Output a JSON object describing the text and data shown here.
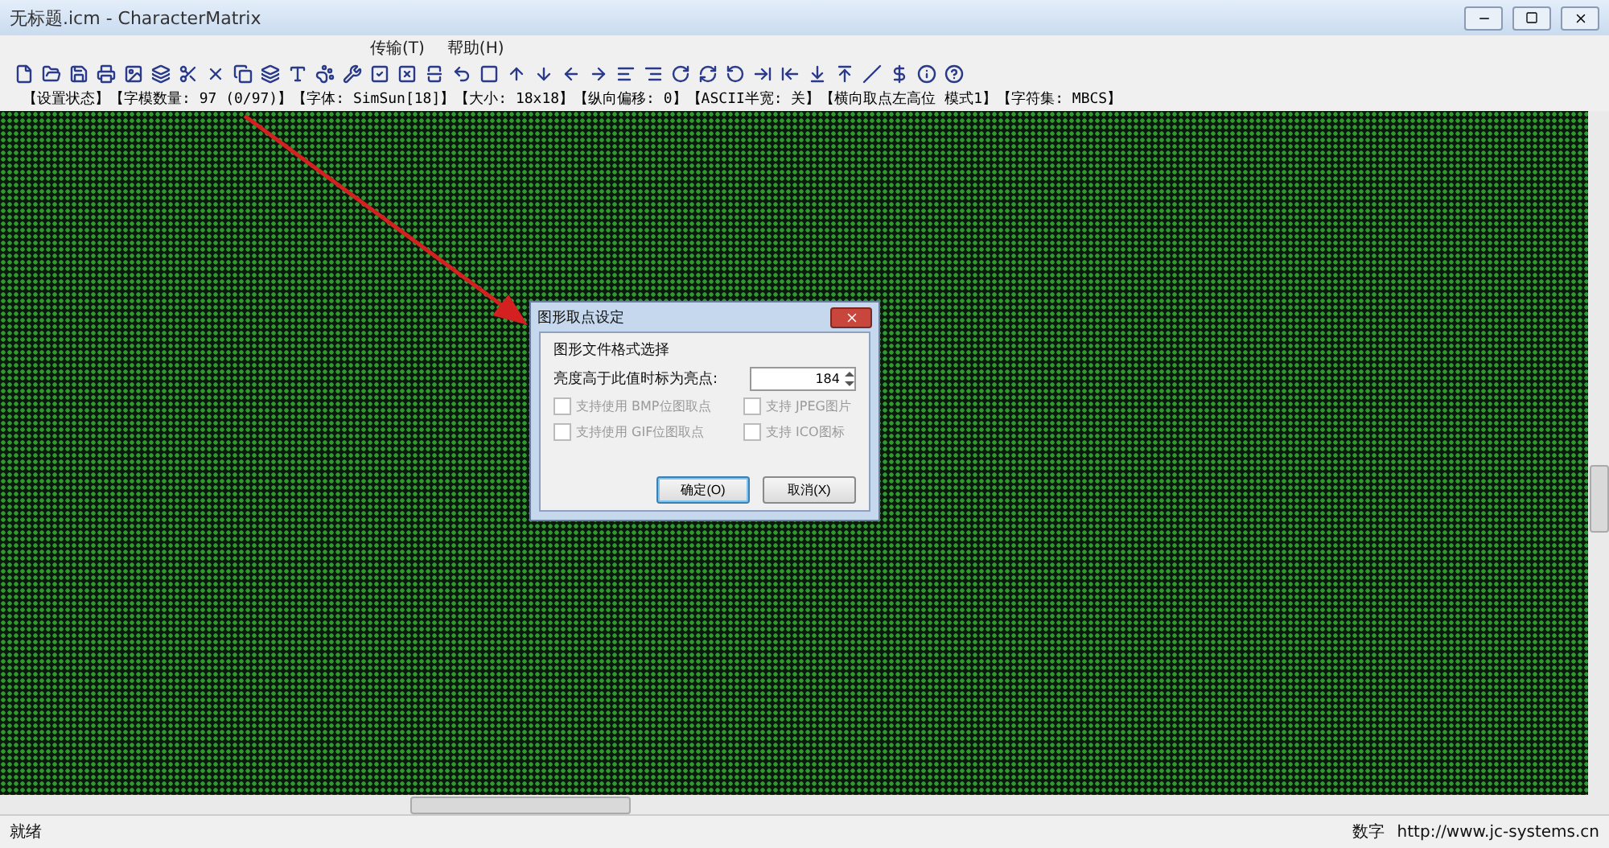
{
  "window": {
    "title": "无标题.icm - CharacterMatrix"
  },
  "menu": [
    "传输(T)",
    "帮助(H)"
  ],
  "info_line": "【设置状态】【字模数量: 97 (0/97)】【字体: SimSun[18]】【大小: 18x18】【纵向偏移: 0】【ASCII半宽: 关】【横向取点左高位 模式1】【字符集: MBCS】",
  "dialog": {
    "title": "图形取点设定",
    "group": "图形文件格式选择",
    "threshold_label": "亮度高于此值时标为亮点:",
    "threshold_value": "184",
    "options": [
      {
        "label": "支持使用 BMP位图取点",
        "checked": false,
        "disabled": true
      },
      {
        "label": "支持 JPEG图片",
        "checked": false,
        "disabled": true
      },
      {
        "label": "支持使用 GIF位图取点",
        "checked": false,
        "disabled": true
      },
      {
        "label": "支持 ICO图标",
        "checked": false,
        "disabled": true
      }
    ],
    "buttons": [
      {
        "label": "确定(O)",
        "selected": true
      },
      {
        "label": "取消(X)",
        "selected": false
      }
    ]
  },
  "status_bar": {
    "left": "就绪",
    "mode": "数字",
    "url": "http://www.jc-systems.cn"
  }
}
